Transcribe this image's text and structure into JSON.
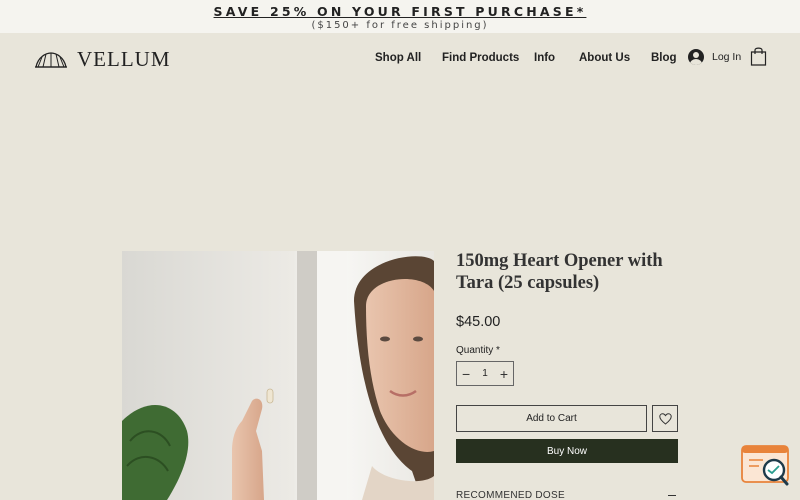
{
  "promo": {
    "title": "SAVE 25% ON YOUR FIRST PURCHASE*",
    "subtitle": "($150+ for free shipping)"
  },
  "brand": {
    "name": "VELLUM"
  },
  "nav": {
    "items": [
      "Shop All",
      "Find Products",
      "Info",
      "About Us",
      "Blog"
    ],
    "login": "Log In"
  },
  "product": {
    "title": "150mg Heart Opener with Tara (25 capsules)",
    "price": "$45.00",
    "quantity_label": "Quantity *",
    "quantity": "1",
    "add_to_cart": "Add to Cart",
    "buy_now": "Buy Now",
    "accordion_label": "RECOMMENED DOSE"
  },
  "colors": {
    "background": "#e8e5da",
    "promo_bar": "#f5f4ef",
    "buy_now": "#27301f",
    "widget_accent": "#e8833a"
  },
  "icons": [
    "logo-shell-icon",
    "user-avatar-icon",
    "shopping-bag-icon",
    "minus-icon",
    "plus-icon",
    "heart-icon",
    "chat-search-icon"
  ]
}
